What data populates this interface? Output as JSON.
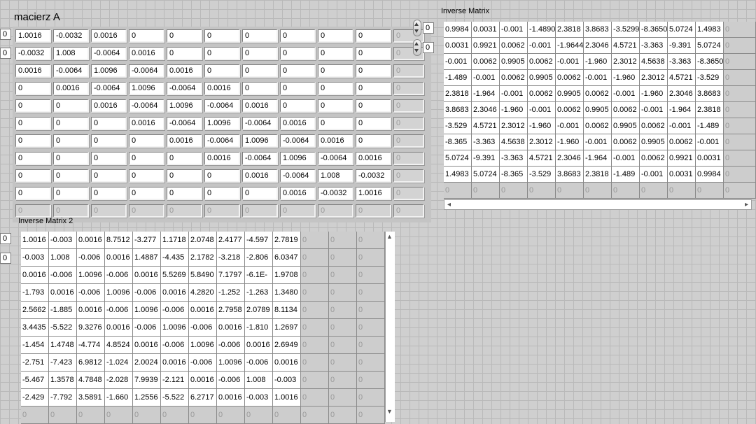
{
  "matrix_a": {
    "label": "macierz A",
    "index_values": [
      "0",
      "0"
    ],
    "rows": [
      [
        "1.0016",
        "-0.0032",
        "0.0016",
        "0",
        "0",
        "0",
        "0",
        "0",
        "0",
        "0"
      ],
      [
        "-0.0032",
        "1.008",
        "-0.0064",
        "0.0016",
        "0",
        "0",
        "0",
        "0",
        "0",
        "0"
      ],
      [
        "0.0016",
        "-0.0064",
        "1.0096",
        "-0.0064",
        "0.0016",
        "0",
        "0",
        "0",
        "0",
        "0"
      ],
      [
        "0",
        "0.0016",
        "-0.0064",
        "1.0096",
        "-0.0064",
        "0.0016",
        "0",
        "0",
        "0",
        "0"
      ],
      [
        "0",
        "0",
        "0.0016",
        "-0.0064",
        "1.0096",
        "-0.0064",
        "0.0016",
        "0",
        "0",
        "0"
      ],
      [
        "0",
        "0",
        "0",
        "0.0016",
        "-0.0064",
        "1.0096",
        "-0.0064",
        "0.0016",
        "0",
        "0"
      ],
      [
        "0",
        "0",
        "0",
        "0",
        "0.0016",
        "-0.0064",
        "1.0096",
        "-0.0064",
        "0.0016",
        "0"
      ],
      [
        "0",
        "0",
        "0",
        "0",
        "0",
        "0.0016",
        "-0.0064",
        "1.0096",
        "-0.0064",
        "0.0016"
      ],
      [
        "0",
        "0",
        "0",
        "0",
        "0",
        "0",
        "0.0016",
        "-0.0064",
        "1.008",
        "-0.0032"
      ],
      [
        "0",
        "0",
        "0",
        "0",
        "0",
        "0",
        "0",
        "0.0016",
        "-0.0032",
        "1.0016"
      ]
    ],
    "empty_value": "0"
  },
  "inverse_matrix": {
    "label": "Inverse Matrix",
    "index_values": [
      "0",
      "0"
    ],
    "rows": [
      [
        "0.9984",
        "0.0031",
        "-0.001",
        "-1.4890",
        "2.3818",
        "3.8683",
        "-3.5299",
        "-8.3650",
        "5.0724",
        "1.4983"
      ],
      [
        "0.0031",
        "0.9921",
        "0.0062",
        "-0.001",
        "-1.9644",
        "2.3046",
        "4.5721",
        "-3.363",
        "-9.391",
        "5.0724"
      ],
      [
        "-0.001",
        "0.0062",
        "0.9905",
        "0.0062",
        "-0.001",
        "-1.960",
        "2.3012",
        "4.5638",
        "-3.363",
        "-8.3650"
      ],
      [
        "-1.489",
        "-0.001",
        "0.0062",
        "0.9905",
        "0.0062",
        "-0.001",
        "-1.960",
        "2.3012",
        "4.5721",
        "-3.529"
      ],
      [
        "2.3818",
        "-1.964",
        "-0.001",
        "0.0062",
        "0.9905",
        "0.0062",
        "-0.001",
        "-1.960",
        "2.3046",
        "3.8683"
      ],
      [
        "3.8683",
        "2.3046",
        "-1.960",
        "-0.001",
        "0.0062",
        "0.9905",
        "0.0062",
        "-0.001",
        "-1.964",
        "2.3818"
      ],
      [
        "-3.529",
        "4.5721",
        "2.3012",
        "-1.960",
        "-0.001",
        "0.0062",
        "0.9905",
        "0.0062",
        "-0.001",
        "-1.489"
      ],
      [
        "-8.365",
        "-3.363",
        "4.5638",
        "2.3012",
        "-1.960",
        "-0.001",
        "0.0062",
        "0.9905",
        "0.0062",
        "-0.001"
      ],
      [
        "5.0724",
        "-9.391",
        "-3.363",
        "4.5721",
        "2.3046",
        "-1.964",
        "-0.001",
        "0.0062",
        "0.9921",
        "0.0031"
      ],
      [
        "1.4983",
        "5.0724",
        "-8.365",
        "-3.529",
        "3.8683",
        "2.3818",
        "-1.489",
        "-0.001",
        "0.0031",
        "0.9984"
      ]
    ],
    "empty_value": "0"
  },
  "inverse_matrix_2": {
    "label": "Inverse Matrix 2",
    "index_values": [
      "0",
      "0"
    ],
    "rows": [
      [
        "1.0016",
        "-0.003",
        "0.0016",
        "8.7512",
        "-3.277",
        "1.1718",
        "2.0748",
        "2.4177",
        "-4.597",
        "2.7819"
      ],
      [
        "-0.003",
        "1.008",
        "-0.006",
        "0.0016",
        "1.4887",
        "-4.435",
        "2.1782",
        "-3.218",
        "-2.806",
        "6.0347"
      ],
      [
        "0.0016",
        "-0.006",
        "1.0096",
        "-0.006",
        "0.0016",
        "5.5269",
        "5.8490",
        "7.1797",
        "-6.1E-",
        "1.9708"
      ],
      [
        "-1.793",
        "0.0016",
        "-0.006",
        "1.0096",
        "-0.006",
        "0.0016",
        "4.2820",
        "-1.252",
        "-1.263",
        "1.3480"
      ],
      [
        "2.5662",
        "-1.885",
        "0.0016",
        "-0.006",
        "1.0096",
        "-0.006",
        "0.0016",
        "2.7958",
        "2.0789",
        "8.1134"
      ],
      [
        "3.4435",
        "-5.522",
        "9.3276",
        "0.0016",
        "-0.006",
        "1.0096",
        "-0.006",
        "0.0016",
        "-1.810",
        "1.2697"
      ],
      [
        "-1.454",
        "1.4748",
        "-4.774",
        "4.8524",
        "0.0016",
        "-0.006",
        "1.0096",
        "-0.006",
        "0.0016",
        "2.6949"
      ],
      [
        "-2.751",
        "-7.423",
        "6.9812",
        "-1.024",
        "2.0024",
        "0.0016",
        "-0.006",
        "1.0096",
        "-0.006",
        "0.0016"
      ],
      [
        "-5.467",
        "1.3578",
        "4.7848",
        "-2.028",
        "7.9939",
        "-2.121",
        "0.0016",
        "-0.006",
        "1.008",
        "-0.003"
      ],
      [
        "-2.429",
        "-7.792",
        "3.5891",
        "-1.660",
        "1.2556",
        "-5.522",
        "6.2717",
        "0.0016",
        "-0.003",
        "1.0016"
      ]
    ],
    "empty_value": "0"
  }
}
